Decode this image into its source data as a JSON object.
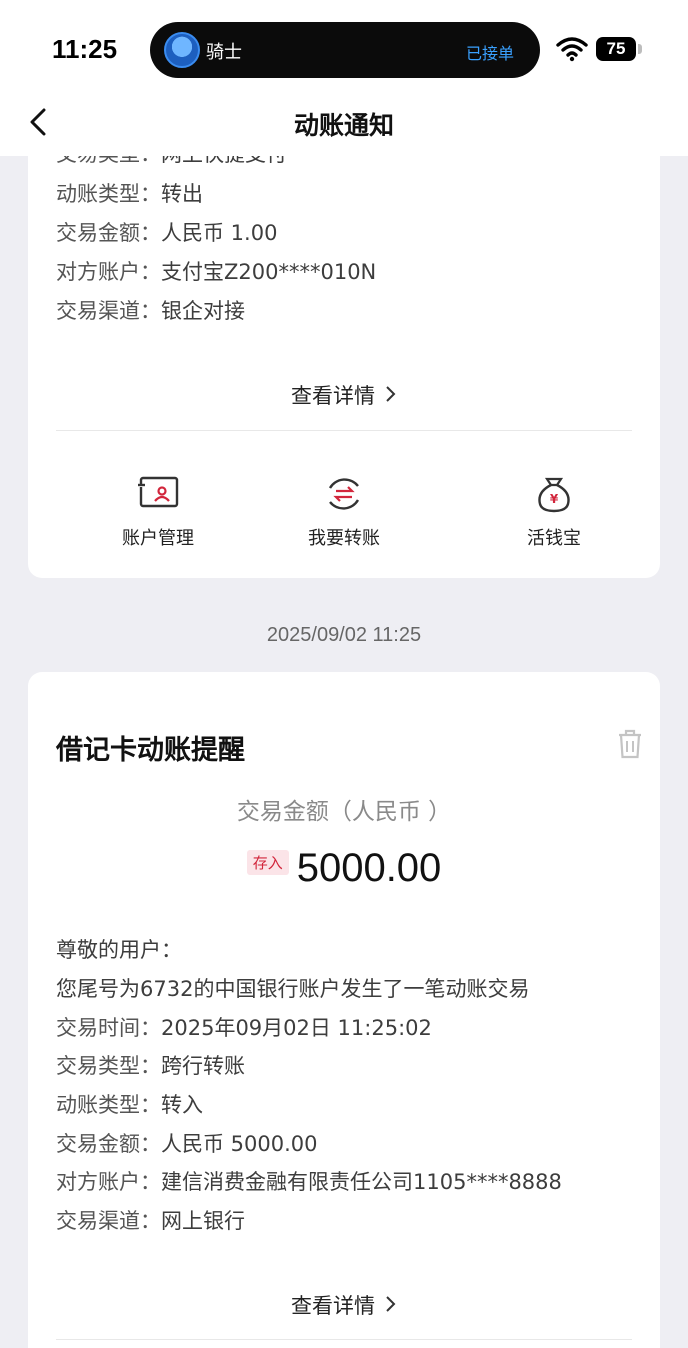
{
  "status_bar": {
    "time": "11:25",
    "island_title": "骑士",
    "island_status": "已接单",
    "battery": "75"
  },
  "nav": {
    "title": "动账通知"
  },
  "card1": {
    "lines": [
      {
        "label": "交易类型：",
        "value": "网上快捷支付"
      },
      {
        "label": "动账类型：",
        "value": "转出"
      },
      {
        "label": "交易金额：",
        "value": "人民币 1.00"
      },
      {
        "label": "对方账户：",
        "value": "支付宝Z200****010N"
      },
      {
        "label": "交易渠道：",
        "value": "银企对接"
      }
    ],
    "view_detail": "查看详情",
    "quick_actions": [
      {
        "label": "账户管理",
        "icon": "account-card-icon"
      },
      {
        "label": "我要转账",
        "icon": "transfer-icon"
      },
      {
        "label": "活钱宝",
        "icon": "money-bag-icon"
      }
    ]
  },
  "timestamp": "2025/09/02 11:25",
  "card2": {
    "title": "借记卡动账提醒",
    "amount_caption": "交易金额（人民币 ）",
    "deposit_badge": "存入",
    "amount": "5000.00",
    "greeting": "尊敬的用户：",
    "message": "您尾号为6732的中国银行账户发生了一笔动账交易",
    "lines": [
      {
        "label": "交易时间：",
        "value": "2025年09月02日 11:25:02"
      },
      {
        "label": "交易类型：",
        "value": "跨行转账"
      },
      {
        "label": "动账类型：",
        "value": "转入"
      },
      {
        "label": "交易金额：",
        "value": "人民币 5000.00"
      },
      {
        "label": "对方账户：",
        "value": "建信消费金融有限责任公司1105****8888"
      },
      {
        "label": "交易渠道：",
        "value": "网上银行"
      }
    ],
    "view_detail": "查看详情"
  },
  "colors": {
    "accent_red": "#d2263c",
    "background": "#eeeef3",
    "island_status": "#3aa1ff"
  }
}
